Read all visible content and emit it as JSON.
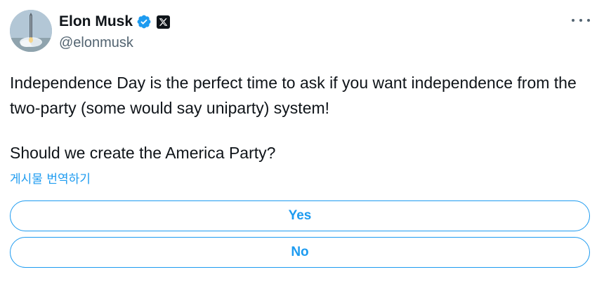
{
  "author": {
    "display_name": "Elon Musk",
    "handle": "@elonmusk",
    "avatar_icon": "rocket-launch-avatar",
    "verified_icon": "verified-badge-icon",
    "affiliate_icon": "x-logo-icon"
  },
  "tweet": {
    "paragraph_1": "Independence Day is the perfect time to ask if you want independence from the two-party (some would say uniparty) system!",
    "paragraph_2": "Should we create the America Party?",
    "translate_label": "게시물 번역하기"
  },
  "poll": {
    "options": [
      {
        "label": "Yes"
      },
      {
        "label": "No"
      }
    ]
  },
  "colors": {
    "accent": "#1d9bf0",
    "text": "#0f1419",
    "secondary_text": "#536471"
  }
}
